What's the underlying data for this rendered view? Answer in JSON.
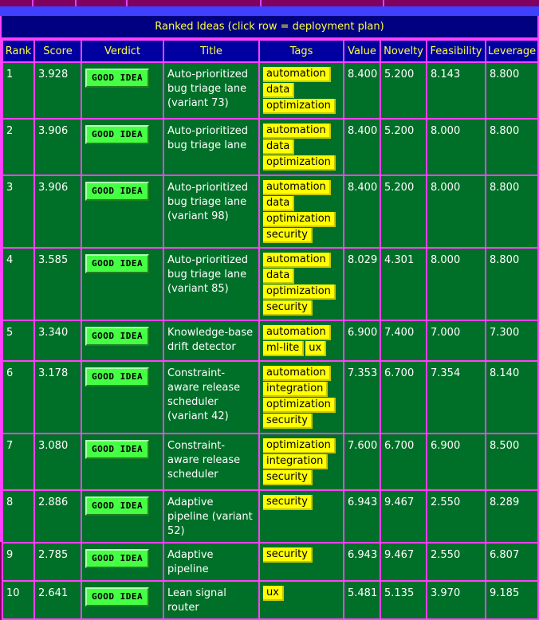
{
  "table": {
    "caption": "Ranked Ideas (click row = deployment plan)",
    "headers": {
      "rank": "Rank",
      "score": "Score",
      "verdict": "Verdict",
      "title": "Title",
      "tags": "Tags",
      "value": "Value",
      "novelty": "Novelty",
      "feasibility": "Feasibility",
      "leverage": "Leverage"
    },
    "rows": [
      {
        "rank": "1",
        "score": "3.928",
        "verdict": "GOOD IDEA",
        "title": "Auto-prioritized bug triage lane (variant 73)",
        "tags": [
          "automation",
          "data",
          "optimization"
        ],
        "value": "8.400",
        "novelty": "5.200",
        "feasibility": "8.143",
        "leverage": "8.800"
      },
      {
        "rank": "2",
        "score": "3.906",
        "verdict": "GOOD IDEA",
        "title": "Auto-prioritized bug triage lane",
        "tags": [
          "automation",
          "data",
          "optimization"
        ],
        "value": "8.400",
        "novelty": "5.200",
        "feasibility": "8.000",
        "leverage": "8.800"
      },
      {
        "rank": "3",
        "score": "3.906",
        "verdict": "GOOD IDEA",
        "title": "Auto-prioritized bug triage lane (variant 98)",
        "tags": [
          "automation",
          "data",
          "optimization",
          "security"
        ],
        "value": "8.400",
        "novelty": "5.200",
        "feasibility": "8.000",
        "leverage": "8.800"
      },
      {
        "rank": "4",
        "score": "3.585",
        "verdict": "GOOD IDEA",
        "title": "Auto-prioritized bug triage lane (variant 85)",
        "tags": [
          "automation",
          "data",
          "optimization",
          "security"
        ],
        "value": "8.029",
        "novelty": "4.301",
        "feasibility": "8.000",
        "leverage": "8.800"
      },
      {
        "rank": "5",
        "score": "3.340",
        "verdict": "GOOD IDEA",
        "title": "Knowledge-base drift detector",
        "tags": [
          "automation",
          "ml-lite",
          "ux"
        ],
        "value": "6.900",
        "novelty": "7.400",
        "feasibility": "7.000",
        "leverage": "7.300"
      },
      {
        "rank": "6",
        "score": "3.178",
        "verdict": "GOOD IDEA",
        "title": "Constraint-aware release scheduler (variant 42)",
        "tags": [
          "automation",
          "integration",
          "optimization",
          "security"
        ],
        "value": "7.353",
        "novelty": "6.700",
        "feasibility": "7.354",
        "leverage": "8.140"
      },
      {
        "rank": "7",
        "score": "3.080",
        "verdict": "GOOD IDEA",
        "title": "Constraint-aware release scheduler",
        "tags": [
          "optimization",
          "integration",
          "security"
        ],
        "value": "7.600",
        "novelty": "6.700",
        "feasibility": "6.900",
        "leverage": "8.500"
      },
      {
        "rank": "8",
        "score": "2.886",
        "verdict": "GOOD IDEA",
        "title": "Adaptive pipeline (variant 52)",
        "tags": [
          "security"
        ],
        "value": "6.943",
        "novelty": "9.467",
        "feasibility": "2.550",
        "leverage": "8.289"
      },
      {
        "rank": "9",
        "score": "2.785",
        "verdict": "GOOD IDEA",
        "title": "Adaptive pipeline",
        "tags": [
          "security"
        ],
        "value": "6.943",
        "novelty": "9.467",
        "feasibility": "2.550",
        "leverage": "6.807"
      },
      {
        "rank": "10",
        "score": "2.641",
        "verdict": "GOOD IDEA",
        "title": "Lean signal router",
        "tags": [
          "ux"
        ],
        "value": "5.481",
        "novelty": "5.135",
        "feasibility": "3.970",
        "leverage": "9.185"
      }
    ]
  },
  "colors": {
    "page_bg": "#800060",
    "panel_bg": "#000080",
    "cell_bg": "#007028",
    "grid": "#ff40ff",
    "header_text": "#ffff40",
    "badge_bg": "#44ff44",
    "tag_bg": "#ffff00"
  }
}
